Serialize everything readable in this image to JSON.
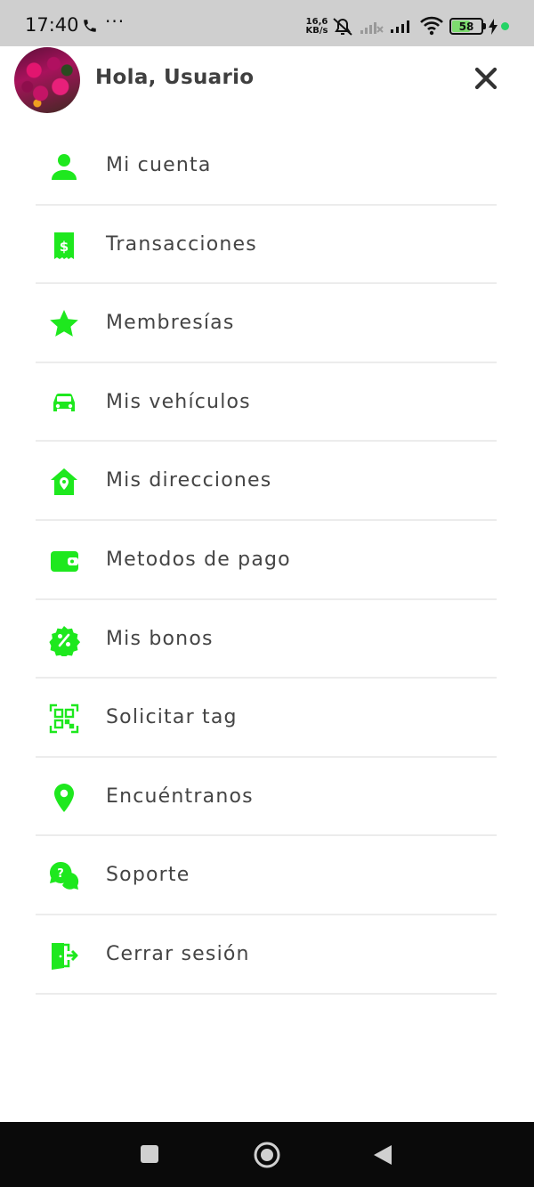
{
  "status_bar": {
    "time": "17:40",
    "more_dots": "···",
    "net_speed_value": "16,6",
    "net_speed_unit": "KB/s",
    "battery_level": "58",
    "icons": [
      "phone-icon",
      "mute-icon",
      "signal-icon",
      "signal-icon",
      "wifi-icon",
      "battery-icon",
      "charging-icon"
    ]
  },
  "header": {
    "greeting": "Hola, Usuario",
    "avatar_icon": "user-avatar",
    "close_icon": "close-icon"
  },
  "menu": {
    "accent_color": "#1ee81e",
    "items": [
      {
        "label": "Mi cuenta",
        "icon": "person-icon"
      },
      {
        "label": "Transacciones",
        "icon": "receipt-icon"
      },
      {
        "label": "Membresías",
        "icon": "star-icon"
      },
      {
        "label": "Mis vehículos",
        "icon": "car-icon"
      },
      {
        "label": "Mis direcciones",
        "icon": "home-location-icon"
      },
      {
        "label": "Metodos de pago",
        "icon": "wallet-icon"
      },
      {
        "label": "Mis bonos",
        "icon": "discount-badge-icon"
      },
      {
        "label": "Solicitar tag",
        "icon": "qr-code-icon"
      },
      {
        "label": "Encuéntranos",
        "icon": "map-pin-icon"
      },
      {
        "label": "Soporte",
        "icon": "help-chat-icon"
      },
      {
        "label": "Cerrar sesión",
        "icon": "logout-icon"
      }
    ]
  },
  "nav_bar": {
    "buttons": [
      "recents-icon",
      "home-icon",
      "back-icon"
    ]
  }
}
